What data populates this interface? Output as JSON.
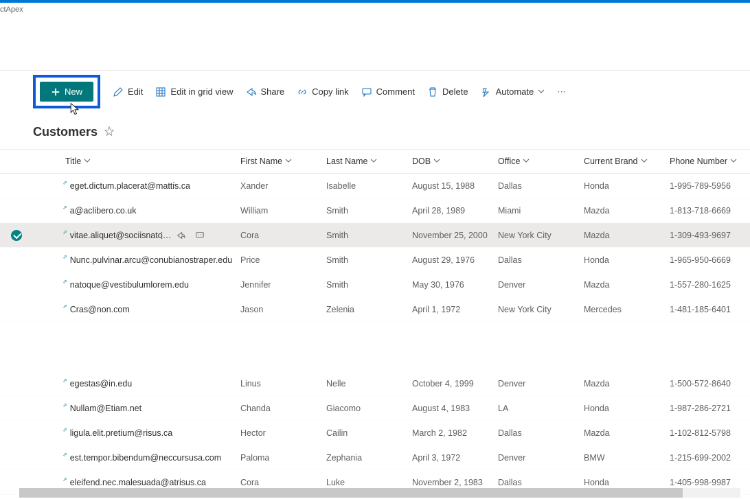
{
  "app_name": "ctApex",
  "toolbar": {
    "new_label": "New",
    "edit_label": "Edit",
    "grid_label": "Edit in grid view",
    "share_label": "Share",
    "copy_label": "Copy link",
    "comment_label": "Comment",
    "delete_label": "Delete",
    "automate_label": "Automate"
  },
  "heading": "Customers",
  "columns": {
    "title": "Title",
    "first": "First Name",
    "last": "Last Name",
    "dob": "DOB",
    "office": "Office",
    "brand": "Current Brand",
    "phone": "Phone Number"
  },
  "rows": [
    {
      "title": "eget.dictum.placerat@mattis.ca",
      "first": "Xander",
      "last": "Isabelle",
      "dob": "August 15, 1988",
      "office": "Dallas",
      "brand": "Honda",
      "phone": "1-995-789-5956"
    },
    {
      "title": "a@aclibero.co.uk",
      "first": "William",
      "last": "Smith",
      "dob": "April 28, 1989",
      "office": "Miami",
      "brand": "Mazda",
      "phone": "1-813-718-6669"
    },
    {
      "title": "vitae.aliquet@sociisnato…",
      "first": "Cora",
      "last": "Smith",
      "dob": "November 25, 2000",
      "office": "New York City",
      "brand": "Mazda",
      "phone": "1-309-493-9697",
      "selected": true
    },
    {
      "title": "Nunc.pulvinar.arcu@conubianostraper.edu",
      "first": "Price",
      "last": "Smith",
      "dob": "August 29, 1976",
      "office": "Dallas",
      "brand": "Honda",
      "phone": "1-965-950-6669"
    },
    {
      "title": "natoque@vestibulumlorem.edu",
      "first": "Jennifer",
      "last": "Smith",
      "dob": "May 30, 1976",
      "office": "Denver",
      "brand": "Mazda",
      "phone": "1-557-280-1625"
    },
    {
      "title": "Cras@non.com",
      "first": "Jason",
      "last": "Zelenia",
      "dob": "April 1, 1972",
      "office": "New York City",
      "brand": "Mercedes",
      "phone": "1-481-185-6401"
    }
  ],
  "rows2": [
    {
      "title": "egestas@in.edu",
      "first": "Linus",
      "last": "Nelle",
      "dob": "October 4, 1999",
      "office": "Denver",
      "brand": "Mazda",
      "phone": "1-500-572-8640"
    },
    {
      "title": "Nullam@Etiam.net",
      "first": "Chanda",
      "last": "Giacomo",
      "dob": "August 4, 1983",
      "office": "LA",
      "brand": "Honda",
      "phone": "1-987-286-2721"
    },
    {
      "title": "ligula.elit.pretium@risus.ca",
      "first": "Hector",
      "last": "Cailin",
      "dob": "March 2, 1982",
      "office": "Dallas",
      "brand": "Mazda",
      "phone": "1-102-812-5798"
    },
    {
      "title": "est.tempor.bibendum@neccursusa.com",
      "first": "Paloma",
      "last": "Zephania",
      "dob": "April 3, 1972",
      "office": "Denver",
      "brand": "BMW",
      "phone": "1-215-699-2002"
    },
    {
      "title": "eleifend.nec.malesuada@atrisus.ca",
      "first": "Cora",
      "last": "Luke",
      "dob": "November 2, 1983",
      "office": "Dallas",
      "brand": "Honda",
      "phone": "1-405-998-9987"
    }
  ]
}
